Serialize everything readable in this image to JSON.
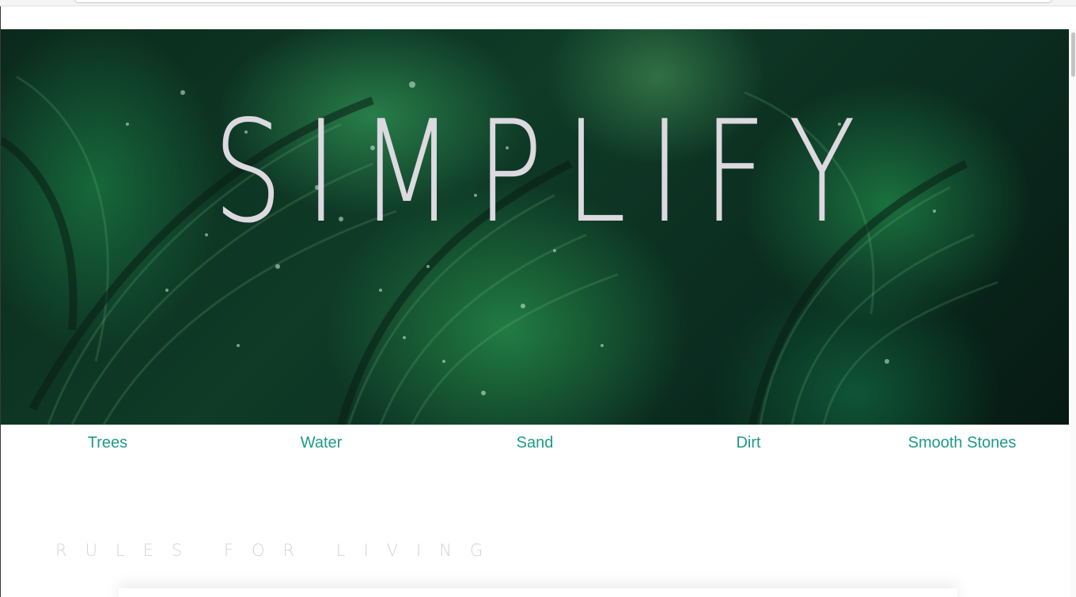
{
  "hero": {
    "title": "SIMPLIFY"
  },
  "nav": {
    "items": [
      {
        "label": "Trees"
      },
      {
        "label": "Water"
      },
      {
        "label": "Sand"
      },
      {
        "label": "Dirt"
      },
      {
        "label": "Smooth Stones"
      }
    ]
  },
  "tagline": "RULES FOR LIVING",
  "colors": {
    "nav_link": "#1f9a8a",
    "hero_title": "#dcd9df",
    "tagline": "#d4d2dc",
    "hero_dark": "#0b2a1d",
    "hero_leaf": "#2c8a50"
  }
}
